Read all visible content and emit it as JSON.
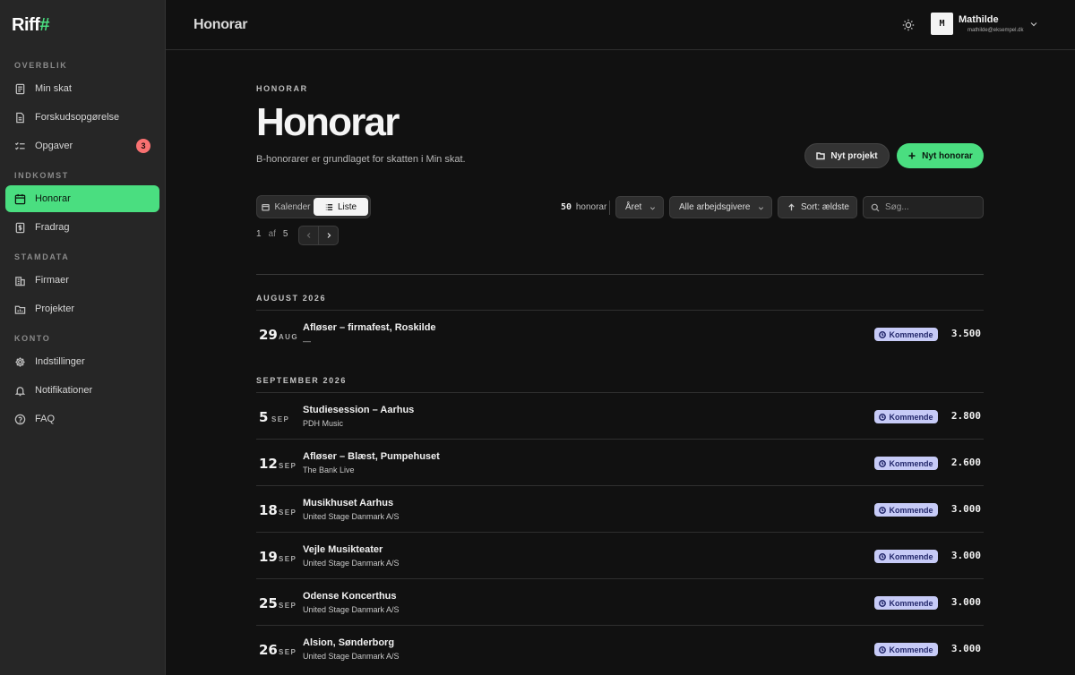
{
  "app": {
    "logo_text": "Riff",
    "logo_accent": "#"
  },
  "sidebar": {
    "sections": [
      {
        "label": "OVERBLIK"
      },
      {
        "label": "INDKOMST"
      },
      {
        "label": "STAMDATA"
      },
      {
        "label": "KONTO"
      }
    ],
    "items": [
      {
        "label": "Min skat",
        "icon": "receipt-icon"
      },
      {
        "label": "Forskudsopgørelse",
        "icon": "document-icon"
      },
      {
        "label": "Opgaver",
        "icon": "checklist-icon",
        "badge": "3"
      },
      {
        "label": "Honorar",
        "icon": "calendar-icon",
        "active": true
      },
      {
        "label": "Fradrag",
        "icon": "dollar-doc-icon"
      },
      {
        "label": "Firmaer",
        "icon": "building-icon"
      },
      {
        "label": "Projekter",
        "icon": "folder-icon"
      },
      {
        "label": "Indstillinger",
        "icon": "gear-icon"
      },
      {
        "label": "Notifikationer",
        "icon": "bell-icon"
      },
      {
        "label": "FAQ",
        "icon": "help-icon"
      }
    ]
  },
  "topbar": {
    "title": "Honorar",
    "user_initial": "M",
    "user_name": "Mathilde",
    "user_email": "mathilde@eksempel.dk"
  },
  "page": {
    "eyebrow": "HONORAR",
    "title": "Honorar",
    "subtitle": "B-honorarer er grundlaget for skatten i Min skat.",
    "btn_project": "Nyt projekt",
    "btn_new": "Nyt honorar"
  },
  "toolbar": {
    "view_calendar": "Kalender",
    "view_list": "Liste",
    "count_num": "50",
    "count_label": "honorar",
    "filter_period": "Året",
    "filter_employer": "Alle arbejdsgivere",
    "sort": "Sort: ældste",
    "search_placeholder": "Søg..."
  },
  "pager": {
    "current": "1",
    "of": "af",
    "total": "5"
  },
  "groups": [
    {
      "month": "AUGUST 2026"
    },
    {
      "month": "SEPTEMBER 2026"
    }
  ],
  "rows": [
    {
      "day": "29",
      "mon": "AUG",
      "title": "Afløser – firmafest, Roskilde",
      "sub": "—",
      "status": "Kommende",
      "amount": "3.500"
    },
    {
      "day": "5",
      "mon": "SEP",
      "title": "Studiesession – Aarhus",
      "sub": "PDH Music",
      "status": "Kommende",
      "amount": "2.800"
    },
    {
      "day": "12",
      "mon": "SEP",
      "title": "Afløser – Blæst, Pumpehuset",
      "sub": "The Bank Live",
      "status": "Kommende",
      "amount": "2.600"
    },
    {
      "day": "18",
      "mon": "SEP",
      "title": "Musikhuset Aarhus",
      "sub": "United Stage Danmark A/S",
      "status": "Kommende",
      "amount": "3.000"
    },
    {
      "day": "19",
      "mon": "SEP",
      "title": "Vejle Musikteater",
      "sub": "United Stage Danmark A/S",
      "status": "Kommende",
      "amount": "3.000"
    },
    {
      "day": "25",
      "mon": "SEP",
      "title": "Odense Koncerthus",
      "sub": "United Stage Danmark A/S",
      "status": "Kommende",
      "amount": "3.000"
    },
    {
      "day": "26",
      "mon": "SEP",
      "title": "Alsion, Sønderborg",
      "sub": "United Stage Danmark A/S",
      "status": "Kommende",
      "amount": "3.000"
    }
  ],
  "colors": {
    "accent": "#4ade80",
    "badge": "#f87171",
    "status_bg": "#c7cbf7"
  }
}
